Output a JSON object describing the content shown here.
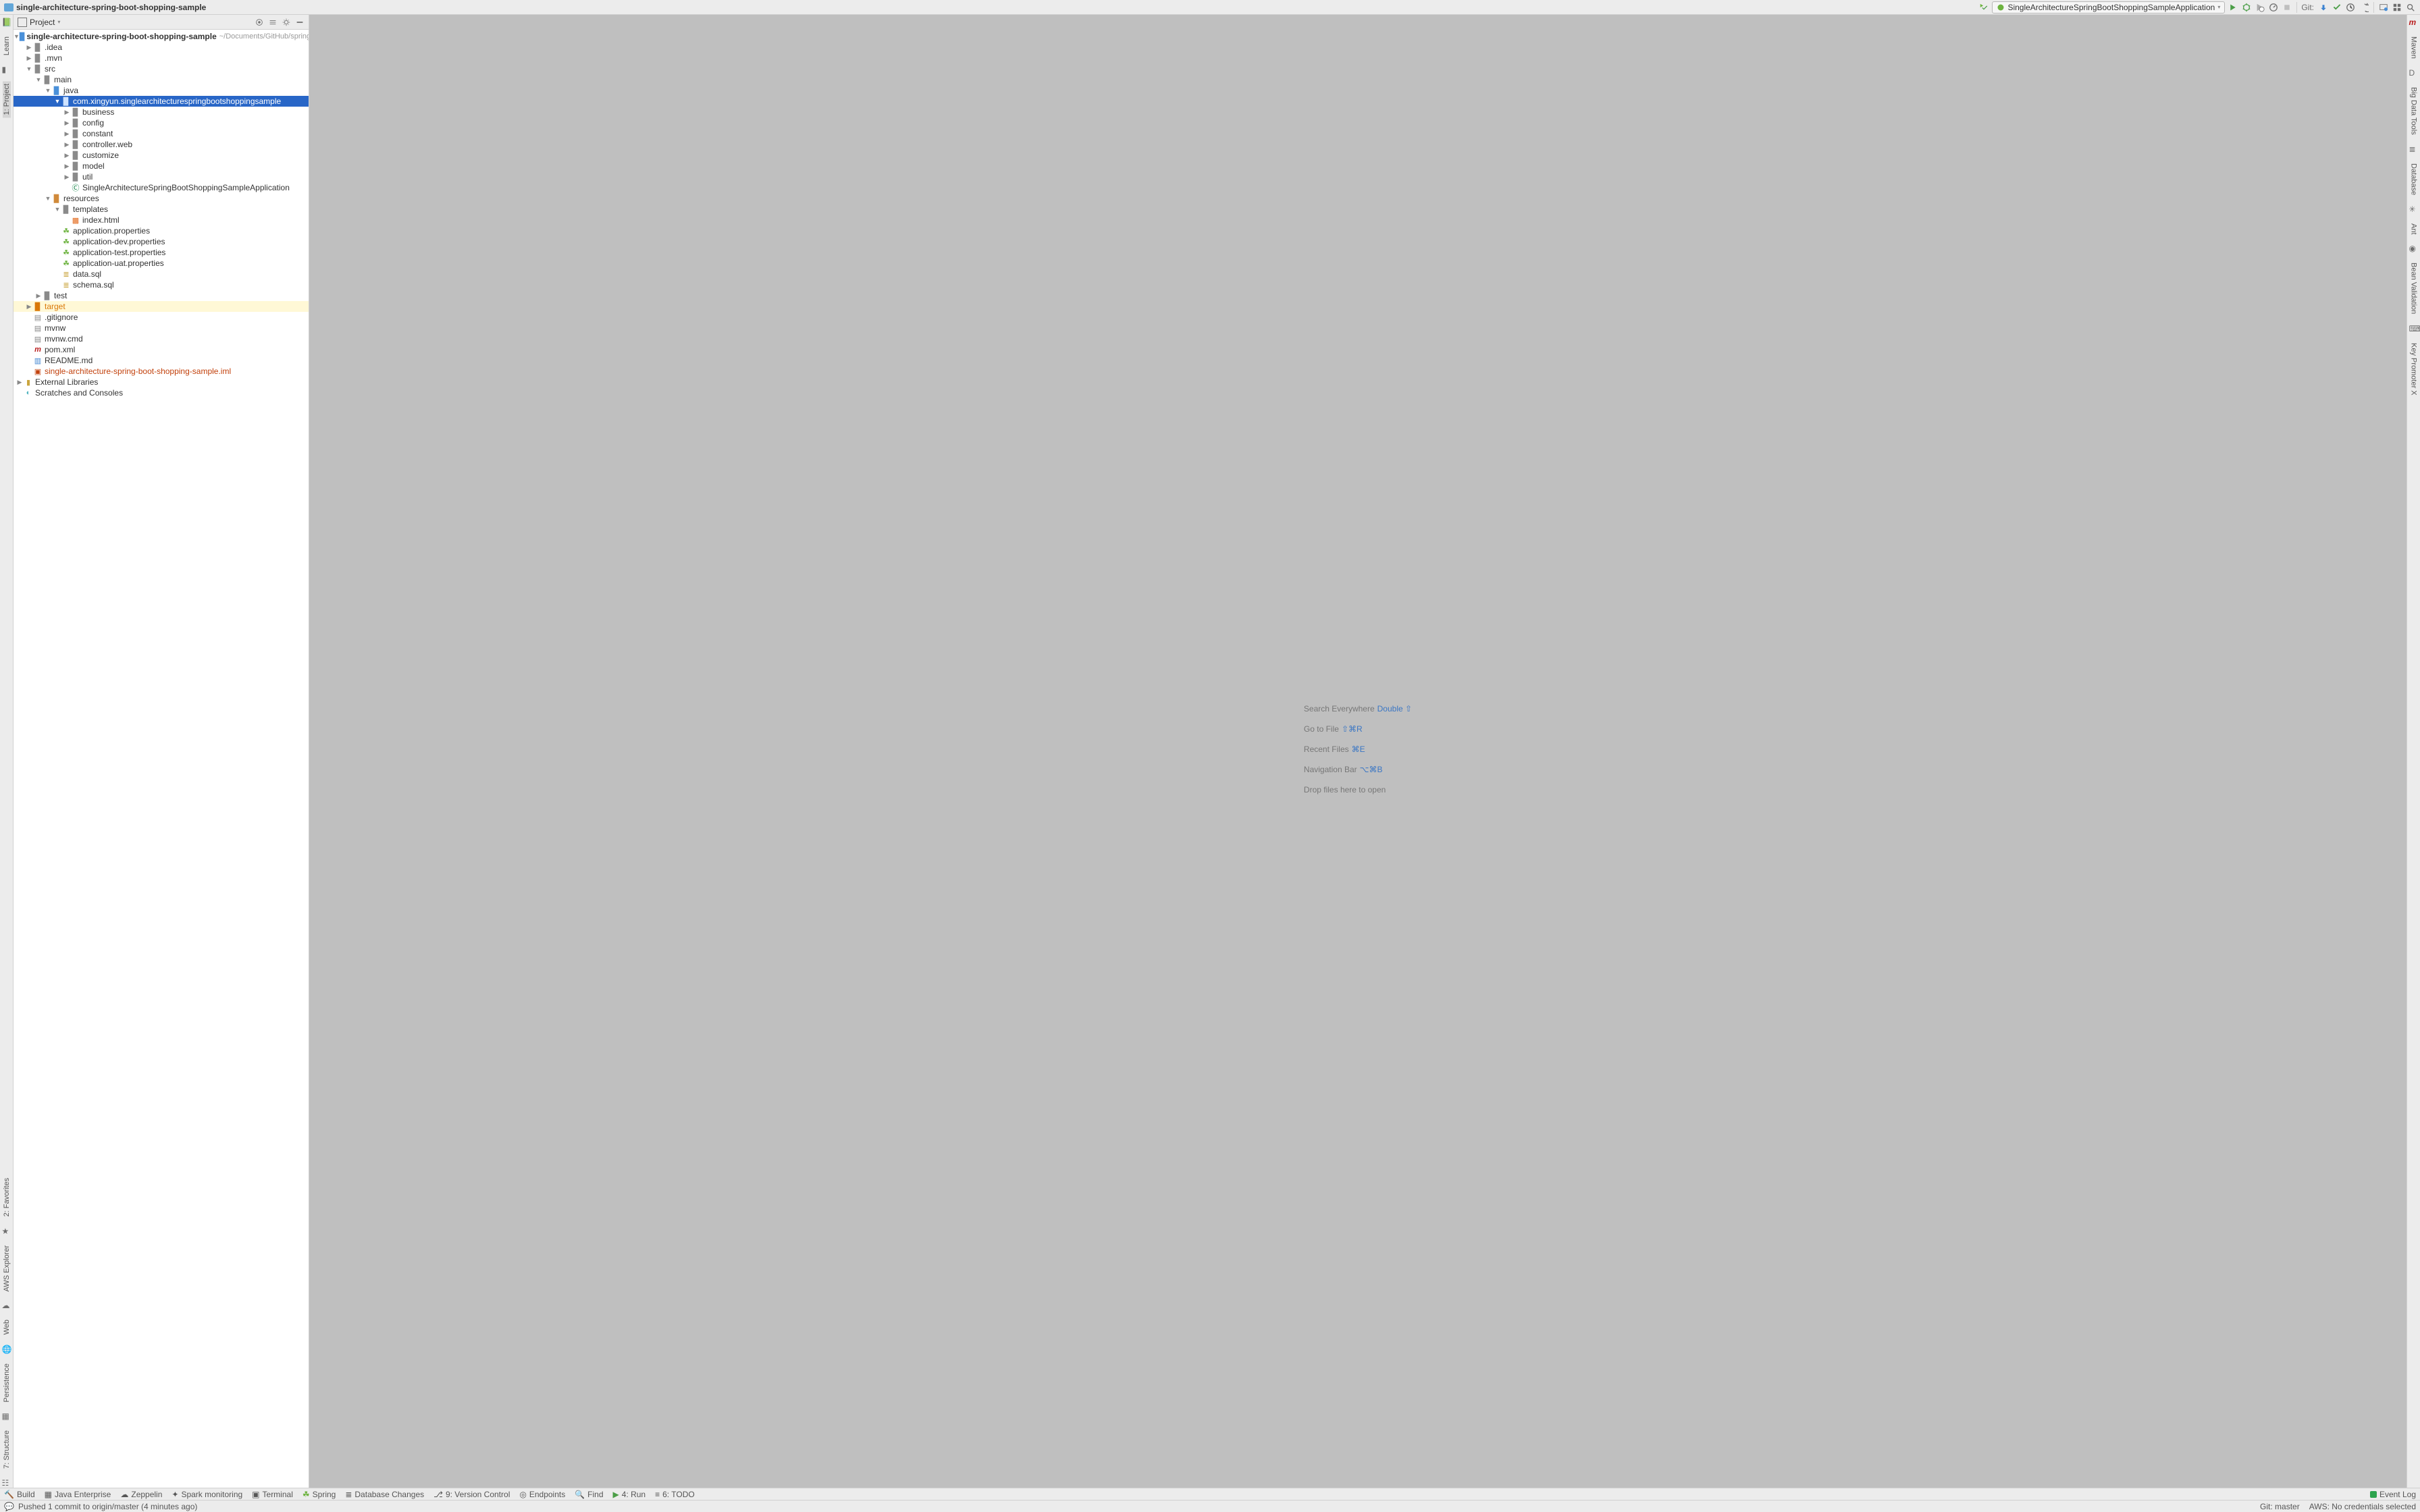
{
  "topbar": {
    "title": "single-architecture-spring-boot-shopping-sample",
    "run_config": "SingleArchitectureSpringBootShoppingSampleApplication",
    "git_label": "Git:"
  },
  "project_panel": {
    "title": "Project"
  },
  "tree": {
    "root_name": "single-architecture-spring-boot-shopping-sample",
    "root_path": "~/Documents/GitHub/spring",
    "idea": ".idea",
    "mvn": ".mvn",
    "src": "src",
    "main": "main",
    "java": "java",
    "pkg": "com.xingyun.singlearchitecturespringbootshoppingsample",
    "business": "business",
    "config": "config",
    "constant": "constant",
    "controller_web": "controller.web",
    "customize": "customize",
    "model": "model",
    "util": "util",
    "app_class": "SingleArchitectureSpringBootShoppingSampleApplication",
    "resources": "resources",
    "templates": "templates",
    "index_html": "index.html",
    "app_props": "application.properties",
    "app_dev_props": "application-dev.properties",
    "app_test_props": "application-test.properties",
    "app_uat_props": "application-uat.properties",
    "data_sql": "data.sql",
    "schema_sql": "schema.sql",
    "test": "test",
    "target": "target",
    "gitignore": ".gitignore",
    "mvnw": "mvnw",
    "mvnw_cmd": "mvnw.cmd",
    "pom_xml": "pom.xml",
    "readme": "README.md",
    "iml": "single-architecture-spring-boot-shopping-sample.iml",
    "ext_lib": "External Libraries",
    "scratches": "Scratches and Consoles"
  },
  "editor_hints": {
    "search_label": "Search Everywhere",
    "search_kb": "Double ⇧",
    "goto_label": "Go to File",
    "goto_kb": "⇧⌘R",
    "recent_label": "Recent Files",
    "recent_kb": "⌘E",
    "nav_label": "Navigation Bar",
    "nav_kb": "⌥⌘B",
    "drop": "Drop files here to open"
  },
  "left_tabs": {
    "learn": "Learn",
    "project": "1: Project",
    "favorites": "2: Favorites",
    "aws": "AWS Explorer",
    "web": "Web",
    "persistence": "Persistence",
    "structure": "7: Structure"
  },
  "right_tabs": {
    "maven": "Maven",
    "big_data": "Big Data Tools",
    "database": "Database",
    "ant": "Ant",
    "bean_validation": "Bean Validation",
    "key_promoter": "Key Promoter X"
  },
  "bottom_tools": {
    "build": "Build",
    "java_enterprise": "Java Enterprise",
    "zeppelin": "Zeppelin",
    "spark": "Spark monitoring",
    "terminal": "Terminal",
    "spring": "Spring",
    "db_changes": "Database Changes",
    "vcs": "9: Version Control",
    "endpoints": "Endpoints",
    "find": "Find",
    "run": "4: Run",
    "todo": "6: TODO",
    "event_log": "Event Log"
  },
  "statusbar": {
    "message": "Pushed 1 commit to origin/master (4 minutes ago)",
    "git": "Git: master",
    "aws": "AWS: No credentials selected"
  }
}
